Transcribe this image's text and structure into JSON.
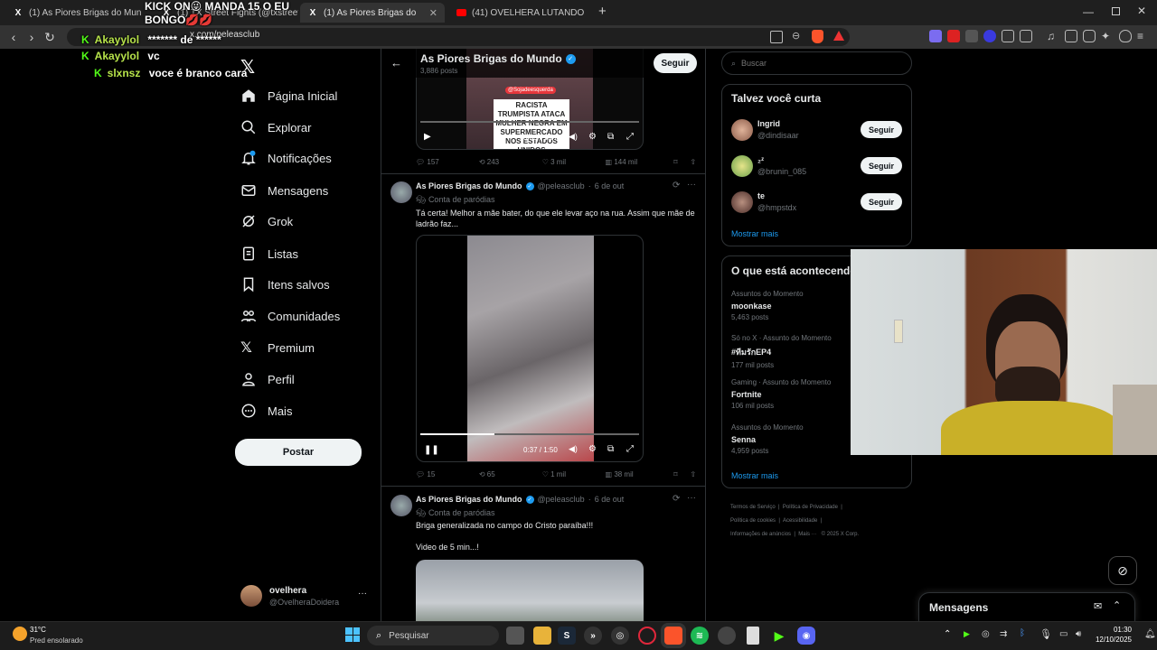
{
  "browser": {
    "tabs": [
      {
        "title": "(1) As Piores Brigas do Mundo no X:",
        "active": false
      },
      {
        "title": "(1) TX Street Fights (@txstreetfights)",
        "active": false
      },
      {
        "title": "(1) As Piores Brigas do Mundo",
        "active": true
      },
      {
        "title": "(41) OVELHERA LUTANDO BOXE KKKK",
        "active": false
      }
    ],
    "url": "x.com/peleasclub"
  },
  "stream_overlay": {
    "banner_line1": "KICK ON😜 MANDA 15 O EU",
    "banner_line2": "BONGO💋💋",
    "chat": [
      {
        "user": "Akayylol",
        "message": "******* de ******"
      },
      {
        "user": "Akayylol",
        "message": "vc"
      },
      {
        "user": "slxnsz",
        "message": "voce é branco cara"
      }
    ]
  },
  "nav": {
    "items": [
      "Página Inicial",
      "Explorar",
      "Notificações",
      "Mensagens",
      "Grok",
      "Listas",
      "Itens salvos",
      "Comunidades",
      "Premium",
      "Perfil",
      "Mais"
    ],
    "post_button": "Postar",
    "account_name": "ovelhera",
    "account_handle": "@OvelheraDoidera",
    "more_dots": "···"
  },
  "header": {
    "title": "As Piores Brigas do Mundo",
    "posts_count": "3,886 posts",
    "follow_label": "Seguir"
  },
  "tweet0": {
    "video_caption": "RACISTA TRUMPISTA ATACA MULHER NEGRA EM SUPERMERCADO NOS ESTADOS UNIDOS",
    "video_tag": "@Sojadeesquerda",
    "video_time": "0:00 / 1:07",
    "replies": "157",
    "reposts": "243",
    "likes": "3 mil",
    "views": "144 mil"
  },
  "tweet1": {
    "name": "As Piores Brigas do Mundo",
    "handle": "@peleasclub",
    "date": "6 de out",
    "label": "Conta de paródias",
    "text": "Tá certa! Melhor a mãe bater, do que ele levar aço na rua. Assim que mãe de ladrão faz...",
    "video_time": "0:37 / 1:50",
    "progress": 0.34,
    "replies": "15",
    "reposts": "65",
    "likes": "1 mil",
    "views": "38 mil"
  },
  "tweet2": {
    "name": "As Piores Brigas do Mundo",
    "handle": "@peleasclub",
    "date": "6 de out",
    "label": "Conta de paródias",
    "text_line1": "Briga generalizada no campo do Cristo paraíba!!!",
    "text_line2": "Video de 5 min...!"
  },
  "search": {
    "placeholder": "Buscar"
  },
  "who_to_follow": {
    "title": "Talvez você curta",
    "users": [
      {
        "name": "Ingrid",
        "handle": "@dindisaar",
        "button": "Seguir"
      },
      {
        "name": "₂ᶻ",
        "handle": "@brunin_085",
        "button": "Seguir"
      },
      {
        "name": "te",
        "handle": "@hmpstdx",
        "button": "Seguir"
      }
    ],
    "show_more": "Mostrar mais"
  },
  "trends": {
    "title": "O que está acontecendo",
    "items": [
      {
        "context": "Assuntos do Momento",
        "name": "moonkase",
        "posts": "5,463 posts"
      },
      {
        "context": "Só no X · Assunto do Momento",
        "name": "#ทีมรักEP4",
        "posts": "177 mil posts"
      },
      {
        "context": "Gaming · Assunto do Momento",
        "name": "Fortnite",
        "posts": "106 mil posts"
      },
      {
        "context": "Assuntos do Momento",
        "name": "Senna",
        "posts": "4,959 posts"
      }
    ],
    "show_more": "Mostrar mais"
  },
  "footer": {
    "links": [
      "Termos de Serviço",
      "Política de Privacidade",
      "Política de cookies",
      "Acessibilidade",
      "Informações de anúncios",
      "Mais ···",
      "© 2025 X Corp."
    ]
  },
  "messages_drawer": {
    "title": "Mensagens"
  },
  "taskbar": {
    "temperature": "31°C",
    "weather": "Pred ensolarado",
    "search_placeholder": "Pesquisar",
    "time": "01:30",
    "date": "12/10/2025"
  },
  "colors": {
    "accent": "#1d9bf0",
    "kick": "#53fc18",
    "background": "#000000",
    "border": "#2f3336"
  }
}
